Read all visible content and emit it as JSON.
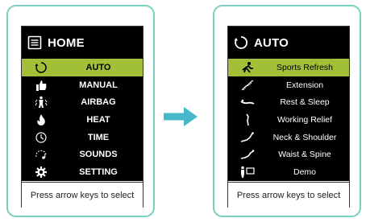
{
  "home": {
    "title": "HOME",
    "items": [
      {
        "label": "AUTO",
        "icon": "auto-cycle-icon",
        "selected": true
      },
      {
        "label": "MANUAL",
        "icon": "thumbs-up-icon",
        "selected": false
      },
      {
        "label": "AIRBAG",
        "icon": "airbag-person-icon",
        "selected": false
      },
      {
        "label": "HEAT",
        "icon": "flame-icon",
        "selected": false
      },
      {
        "label": "TIME",
        "icon": "clock-icon",
        "selected": false
      },
      {
        "label": "SOUNDS",
        "icon": "sound-icon",
        "selected": false
      },
      {
        "label": "SETTING",
        "icon": "gear-icon",
        "selected": false
      }
    ],
    "footer": "Press arrow keys to select"
  },
  "auto": {
    "title": "AUTO",
    "items": [
      {
        "label": "Sports Refresh",
        "icon": "sports-refresh-icon",
        "selected": true
      },
      {
        "label": "Extension",
        "icon": "extension-icon",
        "selected": false
      },
      {
        "label": "Rest & Sleep",
        "icon": "rest-sleep-icon",
        "selected": false
      },
      {
        "label": "Working Relief",
        "icon": "working-relief-icon",
        "selected": false
      },
      {
        "label": "Neck & Shoulder",
        "icon": "neck-shoulder-icon",
        "selected": false
      },
      {
        "label": "Waist & Spine",
        "icon": "waist-spine-icon",
        "selected": false
      },
      {
        "label": "Demo",
        "icon": "demo-icon",
        "selected": false
      }
    ],
    "footer": "Press arrow keys to select"
  },
  "colors": {
    "frame": "#7ccfbf",
    "selected": "#a2c037",
    "arrow": "#46b8c9"
  }
}
